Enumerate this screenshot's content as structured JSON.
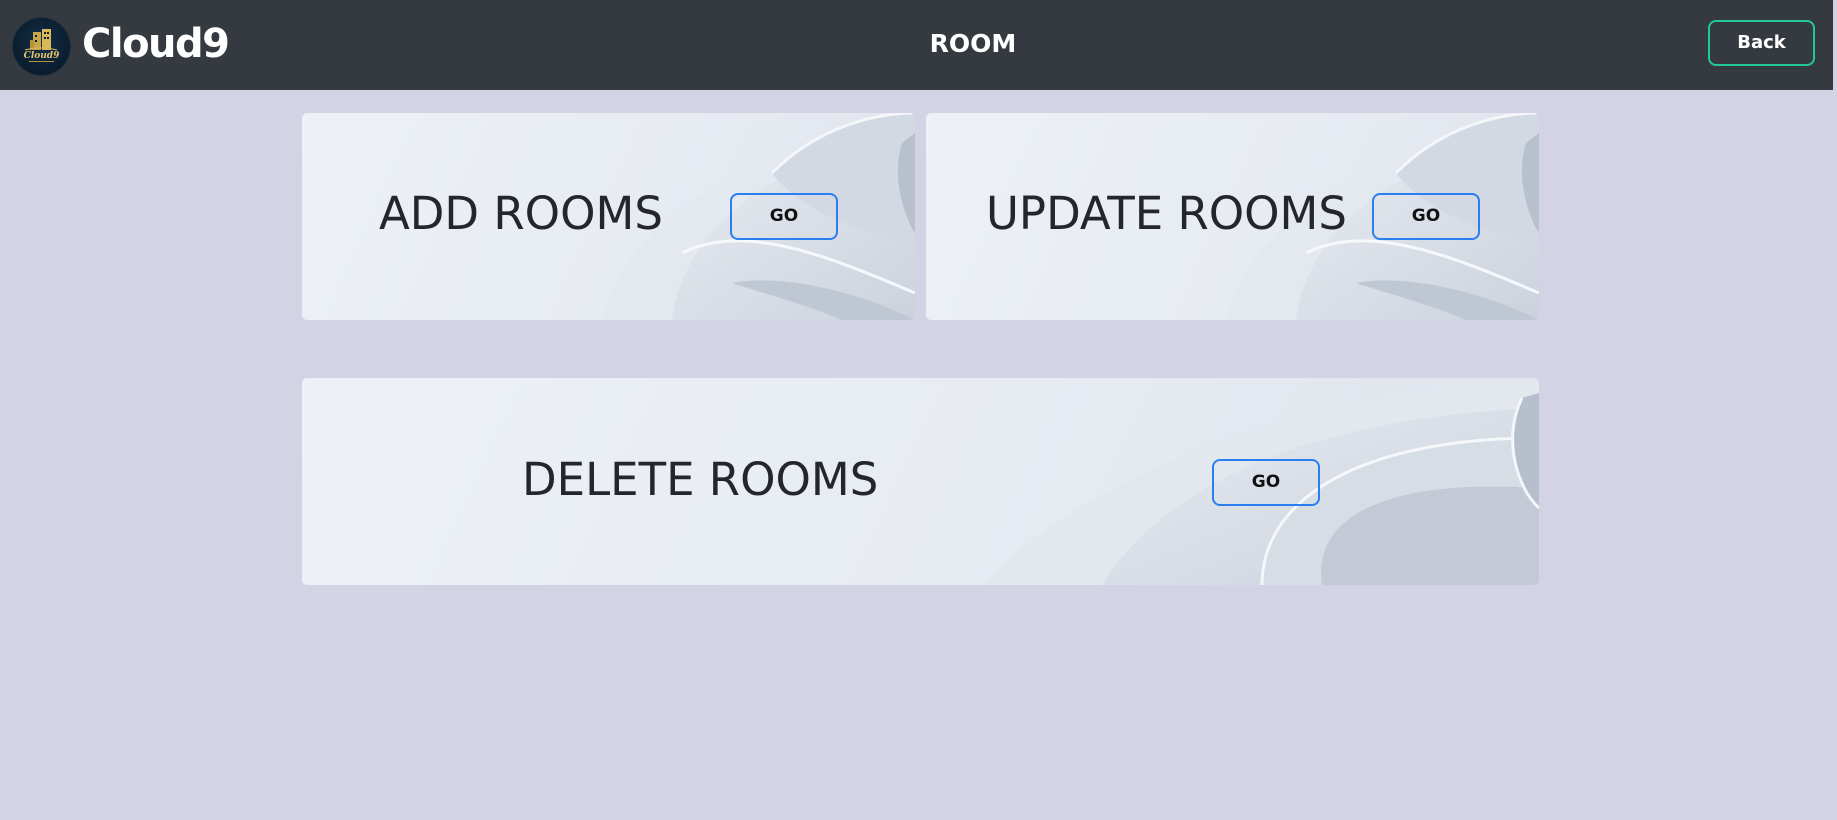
{
  "header": {
    "brand": "Cloud9",
    "logo_text": "Cloud9",
    "title": "ROOM",
    "back_label": "Back"
  },
  "cards": [
    {
      "title": "ADD ROOMS",
      "button_label": "GO"
    },
    {
      "title": "UPDATE ROOMS",
      "button_label": "GO"
    },
    {
      "title": "DELETE ROOMS",
      "button_label": "GO"
    }
  ],
  "colors": {
    "navbar": "#343a40",
    "page_background": "#d4d3e5",
    "back_border": "#20c997",
    "go_border": "#2b7ef0"
  }
}
